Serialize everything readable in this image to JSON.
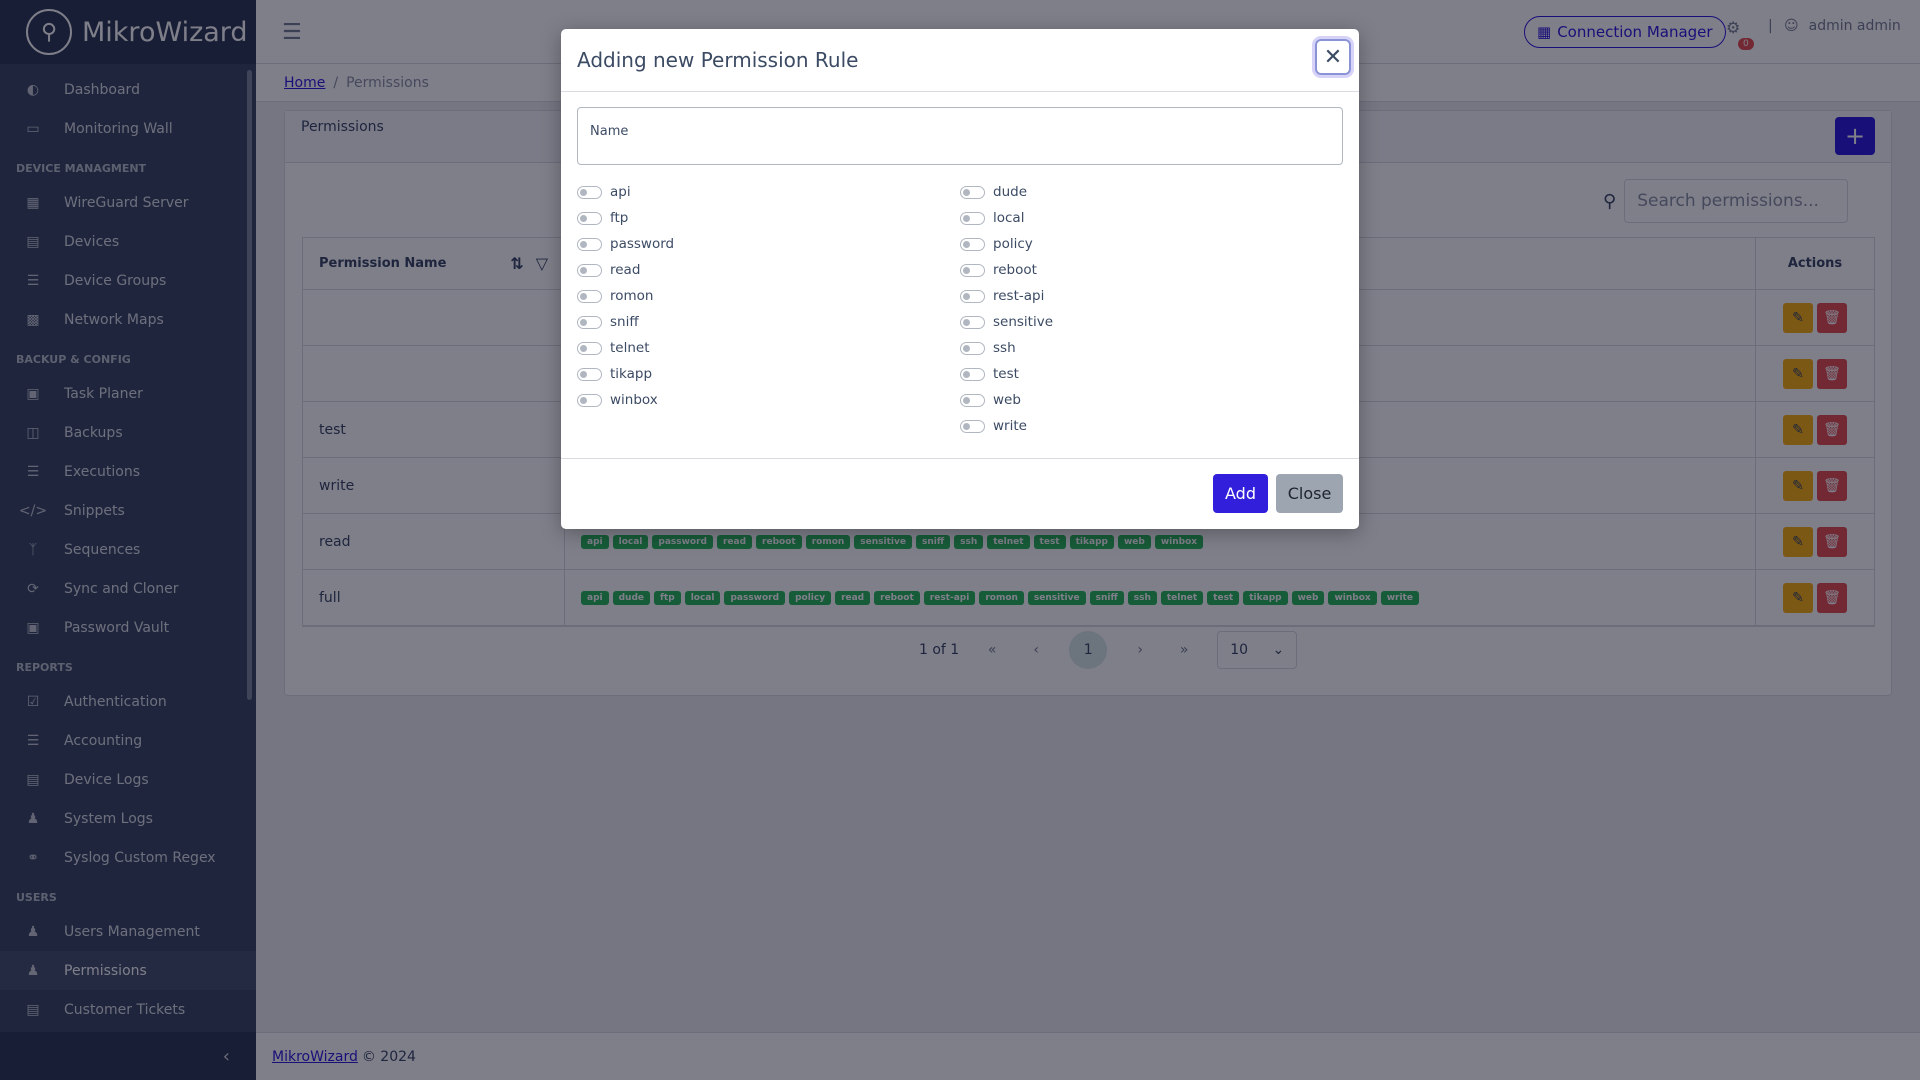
{
  "brand": {
    "name": "MikroWizard"
  },
  "sidebar": {
    "items": [
      {
        "label": "Dashboard",
        "icon": "speedometer-icon"
      },
      {
        "label": "Monitoring Wall",
        "icon": "monitor-icon"
      },
      {
        "section": "DEVICE MANAGMENT"
      },
      {
        "label": "WireGuard Server",
        "icon": "sitemap-icon"
      },
      {
        "label": "Devices",
        "icon": "storage-icon"
      },
      {
        "label": "Device Groups",
        "icon": "layers-icon"
      },
      {
        "label": "Network Maps",
        "icon": "map-icon"
      },
      {
        "section": "BACKUP & CONFIG"
      },
      {
        "label": "Task Planer",
        "icon": "calendar-icon"
      },
      {
        "label": "Backups",
        "icon": "database-icon"
      },
      {
        "label": "Executions",
        "icon": "list-icon"
      },
      {
        "label": "Snippets",
        "icon": "code-icon"
      },
      {
        "label": "Sequences",
        "icon": "branch-icon"
      },
      {
        "label": "Sync and Cloner",
        "icon": "sync-icon"
      },
      {
        "label": "Password Vault",
        "icon": "vault-icon"
      },
      {
        "section": "REPORTS"
      },
      {
        "label": "Authentication",
        "icon": "auth-icon"
      },
      {
        "label": "Accounting",
        "icon": "checklist-icon"
      },
      {
        "label": "Device Logs",
        "icon": "log-icon"
      },
      {
        "label": "System Logs",
        "icon": "person-question-icon"
      },
      {
        "label": "Syslog Custom Regex",
        "icon": "commit-icon"
      },
      {
        "section": "USERS"
      },
      {
        "label": "Users Management",
        "icon": "user-gear-icon"
      },
      {
        "label": "Permissions",
        "icon": "people-icon",
        "active": true
      },
      {
        "label": "Customer Tickets",
        "icon": "ticket-icon"
      }
    ]
  },
  "header": {
    "connection_manager": "Connection Manager",
    "settings_badge": "0",
    "user": "admin admin"
  },
  "breadcrumb": {
    "home": "Home",
    "current": "Permissions"
  },
  "card": {
    "title": "Permissions",
    "search_placeholder": "Search permissions...",
    "columns": {
      "name": "Permission Name",
      "actions": "Actions"
    },
    "rows": [
      {
        "name": "",
        "perms": []
      },
      {
        "name": "",
        "perms": []
      },
      {
        "name": "test",
        "perms": []
      },
      {
        "name": "write",
        "perms": []
      },
      {
        "name": "read",
        "perms": [
          "api",
          "local",
          "password",
          "read",
          "reboot",
          "romon",
          "sensitive",
          "sniff",
          "ssh",
          "telnet",
          "test",
          "tikapp",
          "web",
          "winbox"
        ]
      },
      {
        "name": "full",
        "perms": [
          "api",
          "dude",
          "ftp",
          "local",
          "password",
          "policy",
          "read",
          "reboot",
          "rest-api",
          "romon",
          "sensitive",
          "sniff",
          "ssh",
          "telnet",
          "test",
          "tikapp",
          "web",
          "winbox",
          "write"
        ]
      }
    ],
    "pager": {
      "info": "1 of 1",
      "current": "1",
      "page_size": "10"
    }
  },
  "footer": {
    "link": "MikroWizard",
    "text": "© 2024"
  },
  "modal": {
    "title": "Adding new Permission Rule",
    "name_placeholder": "Name",
    "left_options": [
      "api",
      "ftp",
      "password",
      "read",
      "romon",
      "sniff",
      "telnet",
      "tikapp",
      "winbox"
    ],
    "right_options": [
      "dude",
      "local",
      "policy",
      "reboot",
      "rest-api",
      "sensitive",
      "ssh",
      "test",
      "web",
      "write"
    ],
    "add_label": "Add",
    "close_label": "Close"
  }
}
